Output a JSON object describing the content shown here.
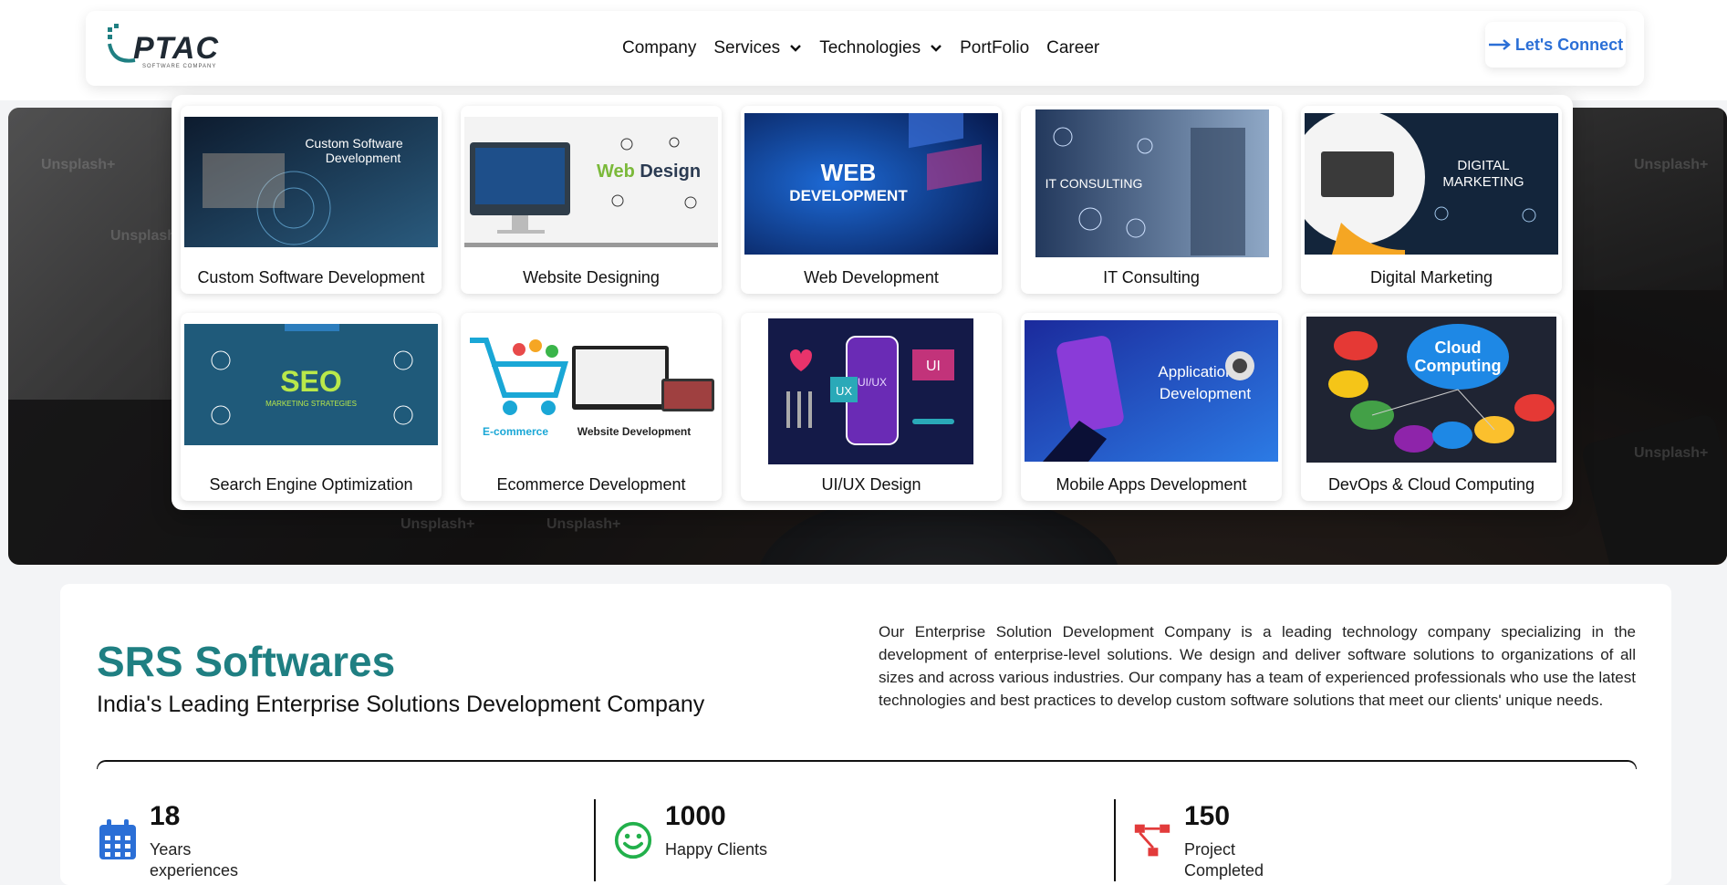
{
  "header": {
    "logo_text": "PTAC",
    "logo_sub": "SOFTWARE COMPANY",
    "nav": [
      {
        "label": "Company"
      },
      {
        "label": "Services"
      },
      {
        "label": "Technologies"
      },
      {
        "label": "PortFolio"
      },
      {
        "label": "Career"
      }
    ],
    "cta": "Let's Connect",
    "accent": "#2b6fd6"
  },
  "hero": {
    "watermark": "Unsplash+"
  },
  "services_menu": {
    "items": [
      {
        "label": "Custom Software Development",
        "thumb_text": "Custom Software Development"
      },
      {
        "label": "Website Designing",
        "thumb_text": "Web Design"
      },
      {
        "label": "Web Development",
        "thumb_text": "WEB DEVELOPMENT"
      },
      {
        "label": "IT Consulting",
        "thumb_text": "IT CONSULTING"
      },
      {
        "label": "Digital Marketing",
        "thumb_text": "DIGITAL MARKETING"
      },
      {
        "label": "Search Engine Optimization",
        "thumb_text": "SEO"
      },
      {
        "label": "Ecommerce Development",
        "thumb_text": "E-commerce Website Development"
      },
      {
        "label": "UI/UX Design",
        "thumb_text": "UI/UX"
      },
      {
        "label": "Mobile Apps Development",
        "thumb_text": "Application Development"
      },
      {
        "label": "DevOps & Cloud Computing",
        "thumb_text": "Cloud Computing"
      }
    ]
  },
  "intro": {
    "title": "SRS Softwares",
    "subtitle": "India's Leading Enterprise Solutions Development Company",
    "about": "Our Enterprise Solution Development Company is a leading technology company specializing in the development of enterprise-level solutions. We design and deliver software solutions to organizations of all sizes and across various industries. Our company has a team of experienced professionals who use the latest technologies and best practices to develop custom software solutions that meet our clients' unique needs.",
    "brand_color": "#1f7f82"
  },
  "stats": [
    {
      "value": "18",
      "label": "Years experiences",
      "icon": "calendar-icon",
      "color": "#2b6fd6"
    },
    {
      "value": "1000",
      "label": "Happy Clients",
      "icon": "smiley-icon",
      "color": "#22b04b"
    },
    {
      "value": "150",
      "label": "Project Completed",
      "icon": "flowchart-icon",
      "color": "#e23b3b"
    }
  ]
}
